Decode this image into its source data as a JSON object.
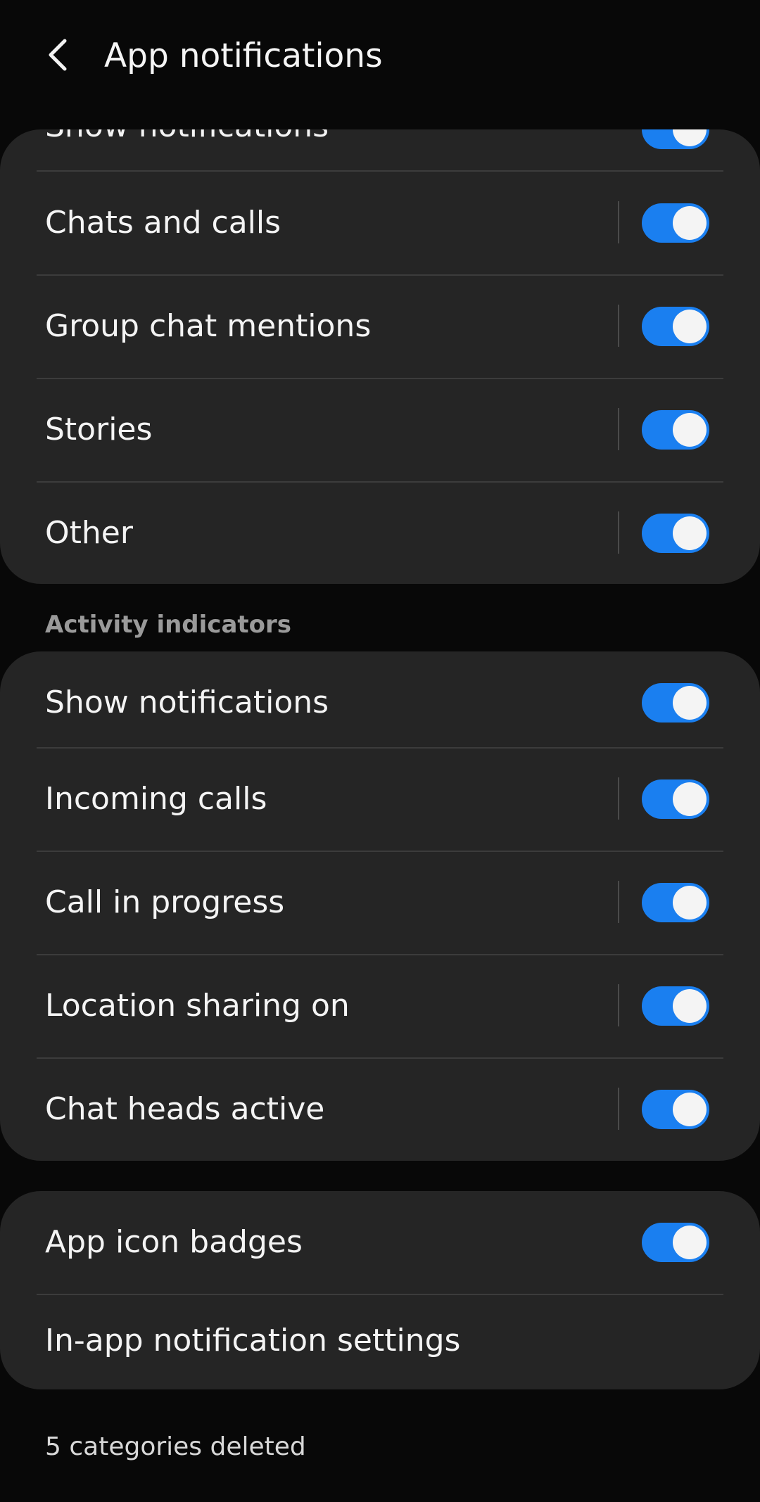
{
  "header": {
    "title": "App notifications",
    "back_icon": "chevron-left-icon"
  },
  "colors": {
    "background": "#080808",
    "card": "#252525",
    "toggle_on": "#1a7ff0",
    "section_header": "#9a9a9a"
  },
  "notification_categories": {
    "partial_item": {
      "label": "Show notifications",
      "enabled": true
    },
    "items": [
      {
        "label": "Chats and calls",
        "enabled": true
      },
      {
        "label": "Group chat mentions",
        "enabled": true
      },
      {
        "label": "Stories",
        "enabled": true
      },
      {
        "label": "Other",
        "enabled": true
      }
    ]
  },
  "activity_indicators": {
    "section_label": "Activity indicators",
    "items": [
      {
        "label": "Show notifications",
        "enabled": true
      },
      {
        "label": "Incoming calls",
        "enabled": true
      },
      {
        "label": "Call in progress",
        "enabled": true
      },
      {
        "label": "Location sharing on",
        "enabled": true
      },
      {
        "label": "Chat heads active",
        "enabled": true
      }
    ]
  },
  "other_settings": {
    "items": [
      {
        "label": "App icon badges",
        "enabled": true
      },
      {
        "label": "In-app notification settings"
      }
    ]
  },
  "footer": {
    "note": "5 categories deleted"
  }
}
